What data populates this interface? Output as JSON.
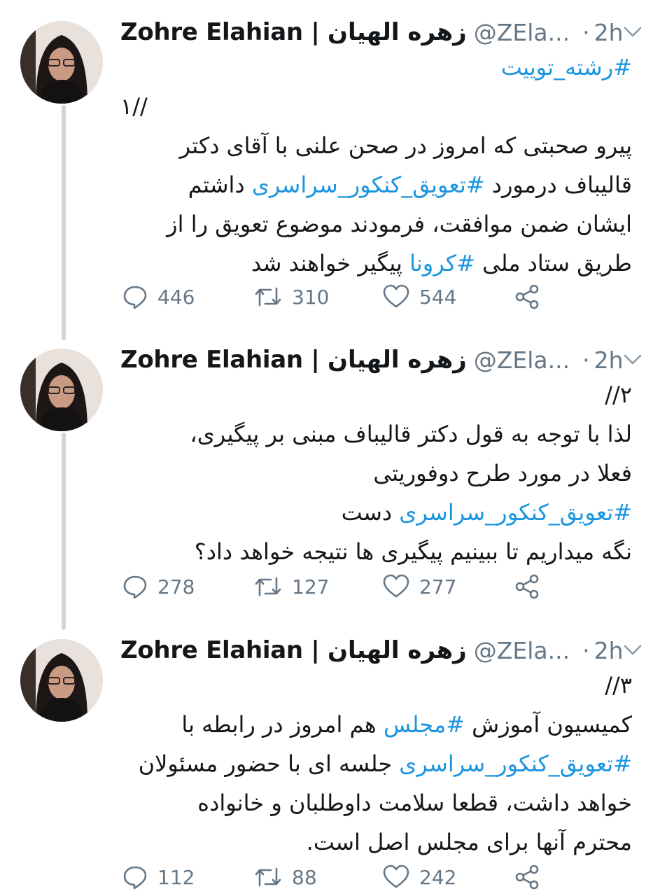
{
  "tweets": [
    {
      "author_name": "Zohre Elahian | زهره الهیان",
      "handle": "@ZEla...",
      "dot": "·",
      "time": "2h",
      "hashtag_top": "#رشته_توییت",
      "index_label": "۱//",
      "lines": [
        {
          "parts": [
            {
              "text": "پیرو صحبتی که امروز در صحن علنی با آقای دکتر",
              "tag": false
            }
          ]
        },
        {
          "parts": [
            {
              "text": "قالیباف درمورد ",
              "tag": false
            },
            {
              "text": "#تعویق_کنکور_سراسری",
              "tag": true
            },
            {
              "text": "  داشتم",
              "tag": false
            }
          ]
        },
        {
          "parts": [
            {
              "text": "ایشان ضمن موافقت، فرمودند موضوع تعویق را از",
              "tag": false
            }
          ]
        },
        {
          "parts": [
            {
              "text": "طریق ستاد ملی ",
              "tag": false
            },
            {
              "text": "#کرونا",
              "tag": true
            },
            {
              "text": " پیگیر خواهند شد",
              "tag": false
            }
          ]
        }
      ],
      "replies": "446",
      "retweets": "310",
      "likes": "544"
    },
    {
      "author_name": "Zohre Elahian | زهره الهیان",
      "handle": "@ZEla...",
      "dot": "·",
      "time": "2h",
      "index_label": "۲//",
      "lines": [
        {
          "parts": [
            {
              "text": "لذا با توجه به قول دکتر قالیباف مبنی بر پیگیری،",
              "tag": false
            }
          ]
        },
        {
          "parts": [
            {
              "text": "فعلا در مورد طرح دوفوریتی",
              "tag": false
            }
          ]
        },
        {
          "parts": [
            {
              "text": "#تعویق_کنکور_سراسری",
              "tag": true
            },
            {
              "text": " دست",
              "tag": false
            }
          ]
        },
        {
          "parts": [
            {
              "text": "نگه میداریم تا ببینیم پیگیری ها نتیجه خواهد داد؟",
              "tag": false
            }
          ]
        }
      ],
      "replies": "278",
      "retweets": "127",
      "likes": "277"
    },
    {
      "author_name": "Zohre Elahian | زهره الهیان",
      "handle": "@ZEla...",
      "dot": "·",
      "time": "2h",
      "index_label": "۳//",
      "lines": [
        {
          "parts": [
            {
              "text": "کمیسیون آموزش ",
              "tag": false
            },
            {
              "text": "#مجلس",
              "tag": true
            },
            {
              "text": " هم امروز در رابطه با",
              "tag": false
            }
          ]
        },
        {
          "parts": [
            {
              "text": "#تعویق_کنکور_سراسری",
              "tag": true
            },
            {
              "text": " جلسه ای با حضور مسئولان",
              "tag": false
            }
          ]
        },
        {
          "parts": [
            {
              "text": "خواهد داشت، قطعا سلامت داوطلبان و خانواده",
              "tag": false
            }
          ]
        },
        {
          "parts": [
            {
              "text": "محترم آنها برای مجلس اصل است.",
              "tag": false
            }
          ]
        }
      ],
      "replies": "112",
      "retweets": "88",
      "likes": "242"
    }
  ],
  "colors": {
    "text": "#14171a",
    "secondary": "#657786",
    "link": "#1b95e0",
    "thread_line": "#ccd6dd"
  },
  "icons": [
    "reply-icon",
    "retweet-icon",
    "like-icon",
    "share-icon",
    "chevron-down-icon"
  ]
}
